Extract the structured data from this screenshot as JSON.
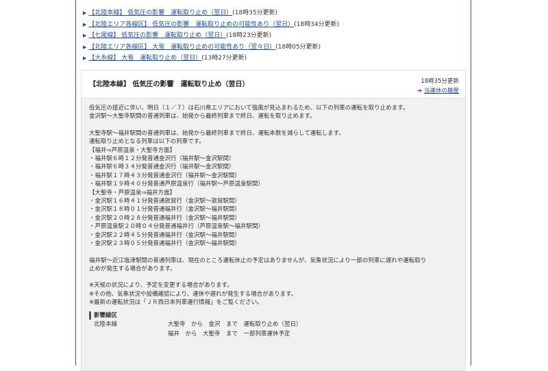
{
  "notices": [
    {
      "link": "【北陸本線】 低気圧の影響　運転取り止め（翌日）",
      "updated": "(18時35分更新)"
    },
    {
      "link": "【北陸エリア各線区】 低気圧の影響　運転取り止めの可能性あり（翌日）",
      "updated": "(18時34分更新)"
    },
    {
      "link": "【七尾線】 低気圧の影響　運転取り止め（翌日）",
      "updated": "(18時23分更新)"
    },
    {
      "link": "【北陸エリア各線区】 大雪　運転取り止めの可能性あり（翌々日）",
      "updated": "(18時05分更新)"
    },
    {
      "link": "【大糸線】 大雪　運転取り止め（翌日）",
      "updated": "(13時27分更新)"
    }
  ],
  "detail": {
    "title": "【北陸本線】 低気圧の影響　運転取り止め（翌日）",
    "updated": "18時35分更新",
    "history_link": "当運休の履歴",
    "paragraph1": [
      "低気圧の接近に伴い、明日（１／７）は石川県エリアにおいて強風が見込まれるため、以下の列車の運転を取り止めます。",
      "金沢駅～大聖寺駅間の普通列車は、始発から最終列車まで終日、運転を取り止めます。"
    ],
    "paragraph2": [
      "大聖寺駅～福井駅間の普通列車は、始発から最終列車まで終日、運転本数を減らして運転します。",
      "運転取り止めとなる列車は以下の列車です。",
      "【福井⇒芦原温泉・大聖寺方面】",
      "・福井駅６時１２分発普通金沢行（福井駅～金沢駅間）",
      "・福井駅６時３４分発普通金沢行（福井駅～金沢駅間）",
      "・福井駅１７時４３分発普通金沢行（福井駅～金沢駅間）",
      "・福井駅１９時４０分発普通芦原温泉行（福井駅～芦原温泉駅間）",
      "【大聖寺・芦原温泉⇒福井方面】",
      "・金沢駅１６時４１分発普通敦賀行（金沢駅～敦賀駅間）",
      "・金沢駅１８時０１分発普通福井行（金沢駅～福井駅間）",
      "・金沢駅２０時２８分発普通福井行（金沢駅～福井駅間）",
      "・芦原温泉駅２０時０４分発普通福井行（芦原温泉駅～福井駅間）",
      "・金沢駅２２時４５分発普通福井行（金沢駅～福井駅間）",
      "・金沢駅２３時０５分発普通福井行（金沢駅～福井駅間）"
    ],
    "paragraph3": [
      "福井駅～近江塩津駅間の普通列車は、現在のところ運転休止の予定はありませんが、気象状況により一部の列車に遅れや運転取り",
      "止めが発生する場合があります。"
    ],
    "notes": [
      "※天候の状況により、予定を変更する場合があります。",
      "※その他、気象状況や設備確認により、運休や遅れが発生する場合があります。",
      "※最新の運転状況は「ＪＲ西日本列車運行情報」をご覧ください。"
    ],
    "affected_title": "影響線区",
    "affected": [
      {
        "line": "北陸本線",
        "text": "大聖寺　から　金沢　まで　運転取り止め（翌日）"
      },
      {
        "line": "",
        "text": "福井　から　大聖寺　まで　一部列車運休予定"
      }
    ]
  }
}
